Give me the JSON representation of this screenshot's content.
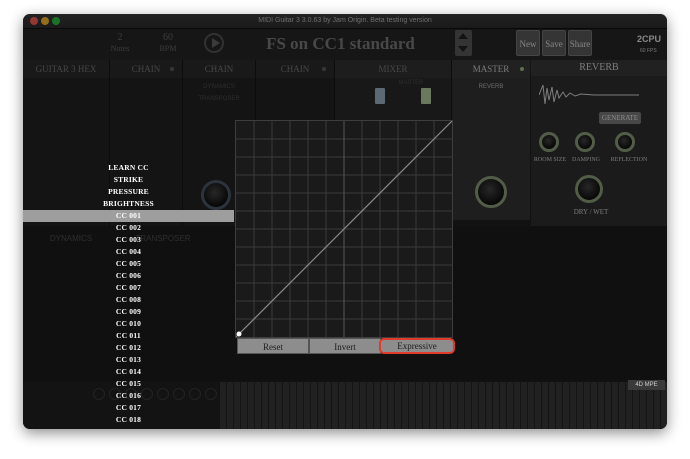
{
  "window": {
    "title": "MIDI Guitar 3 3.0.63 by Jam Origin. Beta testing version"
  },
  "toolbar": {
    "notes_value": "2",
    "notes_label": "Notes",
    "bpm_value": "60",
    "bpm_label": "BPM",
    "preset_name": "FS on CC1 standard",
    "new_label": "New",
    "save_label": "Save",
    "share_label": "Share",
    "cpu_label": "2CPU",
    "fps_label": "60 FPS"
  },
  "panels": {
    "guitar_hex": "GUITAR 3 HEX",
    "chain1": "CHAIN",
    "chain2": "CHAIN",
    "chain2_items": [
      "DYNAMICS",
      "TRANSPOSER"
    ],
    "chain3": "CHAIN",
    "mixer": "MIXER",
    "mixer_master": "MASTER",
    "master": "MASTER",
    "master_sub": "REVERB",
    "lower_dynamics": "DYNAMICS",
    "lower_transposer": "TRANSPOSER"
  },
  "reverb": {
    "title": "REVERB",
    "generate_label": "GENERATE",
    "room_size_label": "ROOM SIZE",
    "damping_label": "DAMPING",
    "reflection_label": "REFLECTION",
    "dry_wet_label": "DRY / WET"
  },
  "keyboard": {
    "mode_label": "4D MPE"
  },
  "cc_menu": {
    "items": [
      "LEARN CC",
      "STRIKE",
      "PRESSURE",
      "BRIGHTNESS",
      "CC 001",
      "CC 002",
      "CC 003",
      "CC 004",
      "CC 005",
      "CC 006",
      "CC 007",
      "CC 008",
      "CC 009",
      "CC 010",
      "CC 011",
      "CC 012",
      "CC 013",
      "CC 014",
      "CC 015",
      "CC 016",
      "CC 017",
      "CC 018"
    ],
    "selected": "CC 001"
  },
  "curve_editor": {
    "reset_label": "Reset",
    "invert_label": "Invert",
    "expressive_label": "Expressive"
  },
  "colors": {
    "highlight_ring": "#e03a2c",
    "selected_item": "#9e9e9e",
    "fader_green": "#b7cfa3",
    "fader_blue": "#9fb3c8"
  }
}
